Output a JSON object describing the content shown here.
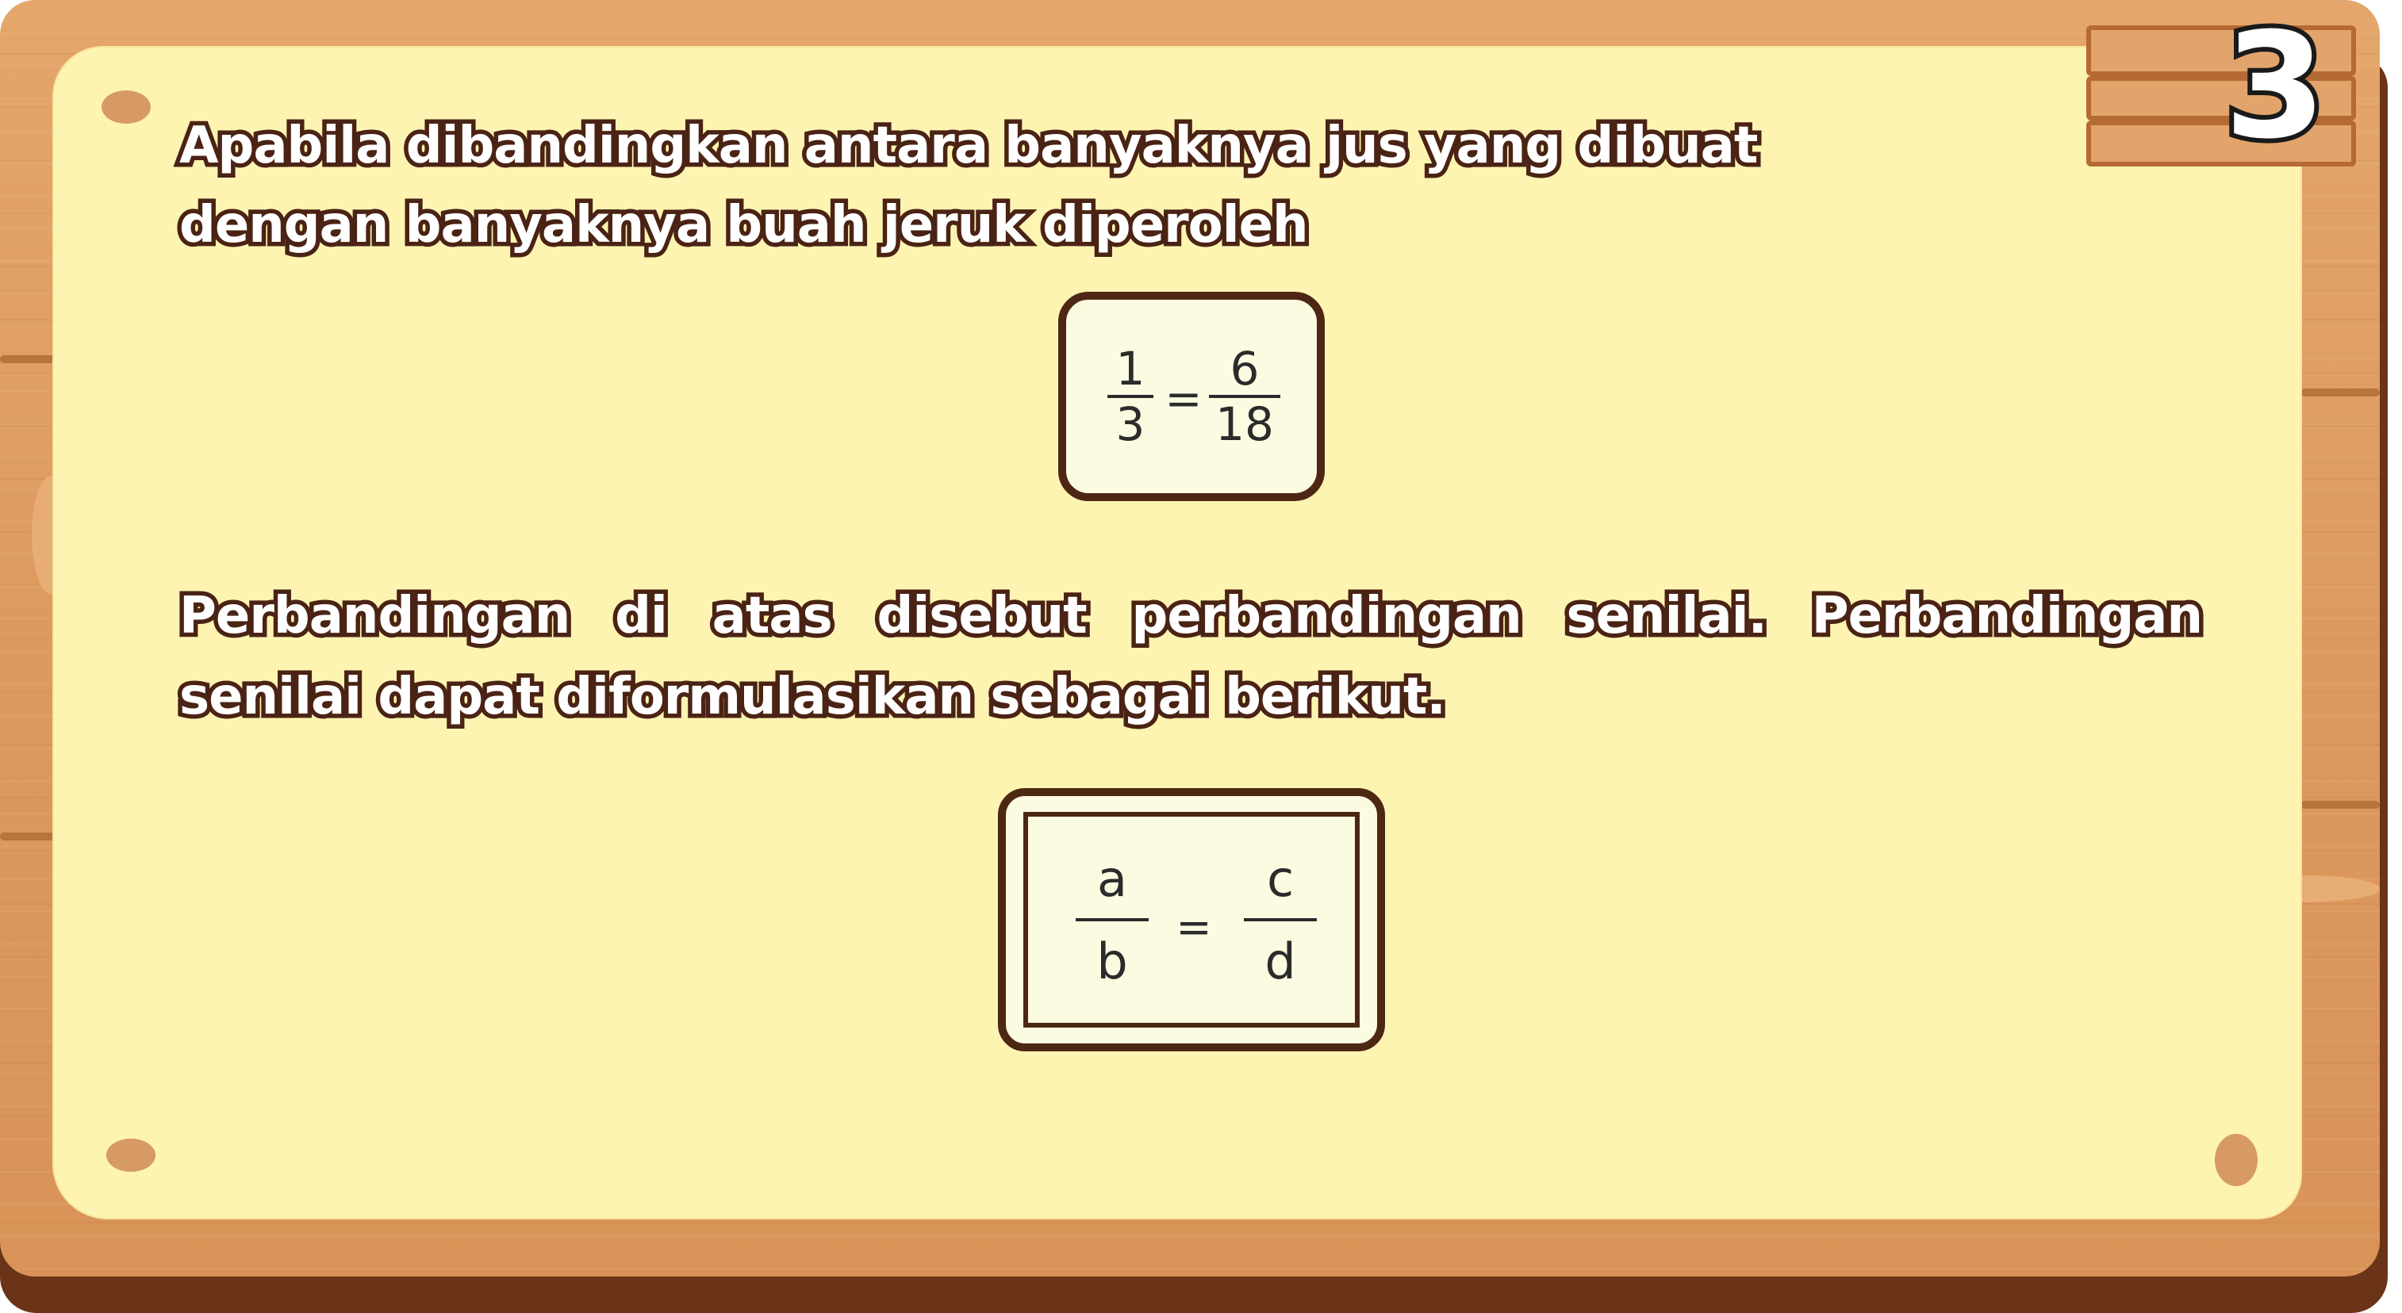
{
  "badge": {
    "number": "3"
  },
  "paragraph_1": "Apabila dibandingkan antara banyaknya jus yang dibuat dengan banyaknya buah jeruk diperoleh",
  "equation_1": {
    "left": {
      "numerator": "1",
      "denominator": "3"
    },
    "operator": "=",
    "right": {
      "numerator": "6",
      "denominator": "18"
    }
  },
  "paragraph_2": "Perbandingan di atas disebut perbandingan senilai. Perbandingan senilai dapat diformulasikan sebagai berikut.",
  "equation_2": {
    "left": {
      "numerator": "a",
      "denominator": "b"
    },
    "operator": "=",
    "right": {
      "numerator": "c",
      "denominator": "d"
    }
  },
  "colors": {
    "wood": "#dc9a5e",
    "wood_shadow": "#6b3418",
    "paper": "#fdf4b1",
    "text_outline": "#4a2315",
    "box_border": "#4d2614"
  }
}
